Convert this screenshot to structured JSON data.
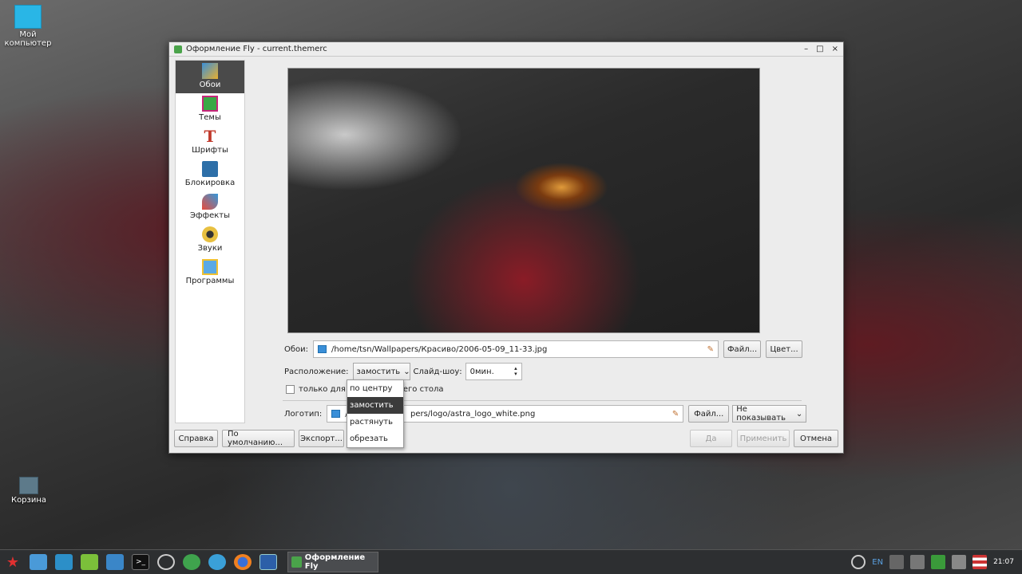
{
  "desktop": {
    "icons": [
      {
        "label": "Мой компьютер"
      },
      {
        "label": "Корзина"
      }
    ]
  },
  "window": {
    "title": "Оформление Fly - current.themerc",
    "controls": [
      "–",
      "□",
      "×"
    ]
  },
  "sidebar": {
    "items": [
      {
        "label": "Обои",
        "icon": "wallpaper-icon"
      },
      {
        "label": "Темы",
        "icon": "themes-icon"
      },
      {
        "label": "Шрифты",
        "icon": "fonts-icon"
      },
      {
        "label": "Блокировка",
        "icon": "lock-screen-icon"
      },
      {
        "label": "Эффекты",
        "icon": "effects-icon"
      },
      {
        "label": "Звуки",
        "icon": "sounds-icon"
      },
      {
        "label": "Программы",
        "icon": "programs-icon"
      }
    ],
    "selected": "Обои"
  },
  "form": {
    "wallpaper_label": "Обои:",
    "wallpaper_path": "/home/tsn/Wallpapers/Красиво/2006-05-09_11-33.jpg",
    "file_button": "Файл...",
    "color_button": "Цвет...",
    "placement_label": "Расположение:",
    "placement_value": "замостить",
    "slideshow_label": "Слайд-шоу:",
    "slideshow_value": "0мин.",
    "checkbox_label_start": "только для т",
    "checkbox_label_end": "его стола",
    "logo_label": "Логотип:",
    "logo_path_start": "/u",
    "logo_path_end": "pers/logo/astra_logo_white.png",
    "logo_file_button": "Файл...",
    "logo_show_value": "Не показывать"
  },
  "dropdown": {
    "options": [
      "по центру",
      "замостить",
      "растянуть",
      "обрезать"
    ],
    "highlighted": "замостить"
  },
  "footer": {
    "help": "Справка",
    "defaults": "По умолчанию...",
    "export": "Экспорт...",
    "yes": "Да",
    "apply": "Применить",
    "cancel": "Отмена"
  },
  "taskbar": {
    "task_label": "Оформление Fly",
    "lang": "EN",
    "time": "21:07"
  }
}
